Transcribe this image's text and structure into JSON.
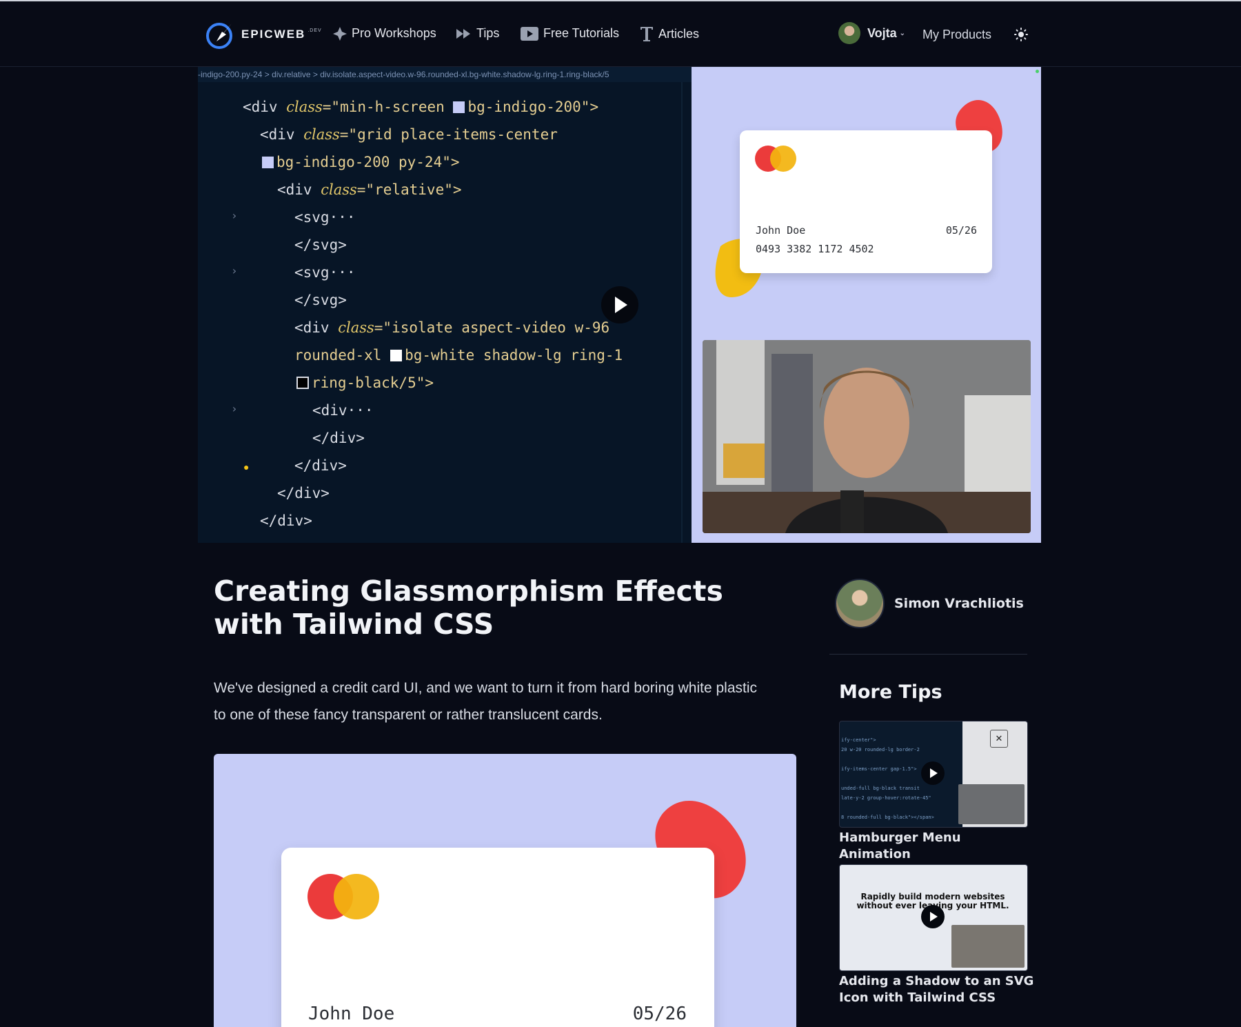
{
  "nav": {
    "logo_text": "EPICWEB",
    "logo_suffix": ".DEV",
    "items": [
      {
        "label": "Pro Workshops",
        "icon": "sparkle-icon"
      },
      {
        "label": "Tips",
        "icon": "fast-forward-icon"
      },
      {
        "label": "Free Tutorials",
        "icon": "play-box-icon"
      },
      {
        "label": "Articles",
        "icon": "text-t-icon"
      }
    ],
    "user_name": "Vojta",
    "my_products": "My Products"
  },
  "video": {
    "breadcrumb": "-indigo-200.py-24  >  div.relative  >  div.isolate.aspect-video.w-96.rounded-xl.bg-white.shadow-lg.ring-1.ring-black/5",
    "code": {
      "l1_a": "<div ",
      "l1_attr": "class",
      "l1_b": "=\"min-h-screen ",
      "l1_c": "bg-indigo-200\">",
      "l2_a": "<div ",
      "l2_attr": "class",
      "l2_b": "=\"grid place-items-center",
      "l3_a": "bg-indigo-200 py-24\">",
      "l4_a": "<div ",
      "l4_attr": "class",
      "l4_b": "=\"relative\">",
      "l5": "<svg···",
      "l6": "</svg>",
      "l7": "<svg···",
      "l8": "</svg>",
      "l9_a": "<div ",
      "l9_attr": "class",
      "l9_b": "=\"isolate aspect-video w-96",
      "l10_a": "rounded-xl ",
      "l10_b": "bg-white shadow-lg ring-1",
      "l11_a": "ring-black/5\">",
      "l12": "<div···",
      "l13": "</div>",
      "l14": "</div>",
      "l15": "</div>",
      "l16": "</div>"
    },
    "card": {
      "name": "John Doe",
      "expiry": "05/26",
      "number": "0493 3382 1172 4502"
    }
  },
  "article": {
    "title": "Creating Glassmorphism Effects with Tailwind CSS",
    "description": "We've designed a credit card UI, and we want to turn it from hard boring white plastic to one of these fancy transparent or rather translucent cards.",
    "embed_card": {
      "name": "John Doe",
      "expiry": "05/26"
    }
  },
  "sidebar": {
    "author_name": "Simon Vrachliotis",
    "more_tips_heading": "More Tips",
    "tips": [
      {
        "title": "Hamburger Menu Animation"
      },
      {
        "title": "Adding a Shadow to an SVG Icon with Tailwind CSS",
        "thumb_headline": "Rapidly build modern websites without ever leaving your HTML."
      }
    ]
  },
  "colors": {
    "background": "#080b16",
    "code_bg": "#071526",
    "preview_bg": "#c6ccf7",
    "mastercard_red": "#eb3b3b",
    "mastercard_yellow": "#f3b40f",
    "blob_red": "#ee4040",
    "blob_yellow": "#f2bd12"
  }
}
